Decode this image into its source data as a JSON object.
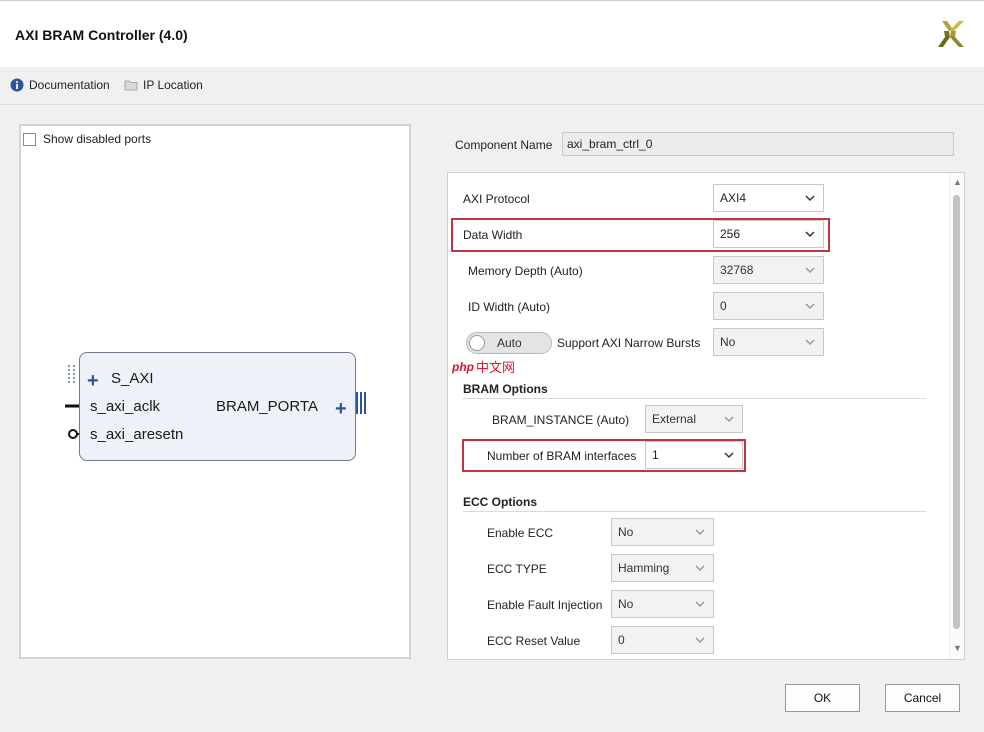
{
  "window": {
    "title": "AXI BRAM Controller (4.0)",
    "logo_icon": "xilinx-logo"
  },
  "toolbar": {
    "documentation": "Documentation",
    "ip_location": "IP Location"
  },
  "symbol": {
    "show_disabled_ports": "Show disabled ports",
    "ports_left": [
      "S_AXI",
      "s_axi_aclk",
      "s_axi_aresetn"
    ],
    "ports_right": [
      "BRAM_PORTA"
    ]
  },
  "component": {
    "label": "Component Name",
    "value": "axi_bram_ctrl_0"
  },
  "fields": {
    "axi_protocol": {
      "label": "AXI Protocol",
      "value": "AXI4"
    },
    "data_width": {
      "label": "Data Width",
      "value": "256"
    },
    "memory_depth": {
      "label": "Memory Depth (Auto)",
      "value": "32768"
    },
    "id_width": {
      "label": "ID Width (Auto)",
      "value": "0"
    },
    "narrow_bursts": {
      "toggle": "Auto",
      "label": "Support AXI Narrow Bursts",
      "value": "No"
    }
  },
  "bram_options": {
    "heading": "BRAM Options",
    "instance": {
      "label": "BRAM_INSTANCE (Auto)",
      "value": "External"
    },
    "num_interfaces": {
      "label": "Number of BRAM interfaces",
      "value": "1"
    }
  },
  "ecc_options": {
    "heading": "ECC Options",
    "enable_ecc": {
      "label": "Enable ECC",
      "value": "No"
    },
    "ecc_type": {
      "label": "ECC TYPE",
      "value": "Hamming"
    },
    "fault_injection": {
      "label": "Enable Fault Injection",
      "value": "No"
    },
    "reset_value": {
      "label": "ECC Reset Value",
      "value": "0"
    }
  },
  "watermark": {
    "php": "php",
    "text": "中文网"
  },
  "buttons": {
    "ok": "OK",
    "cancel": "Cancel"
  },
  "colors": {
    "highlight": "#c0343e",
    "port_blue": "#2f5597"
  }
}
